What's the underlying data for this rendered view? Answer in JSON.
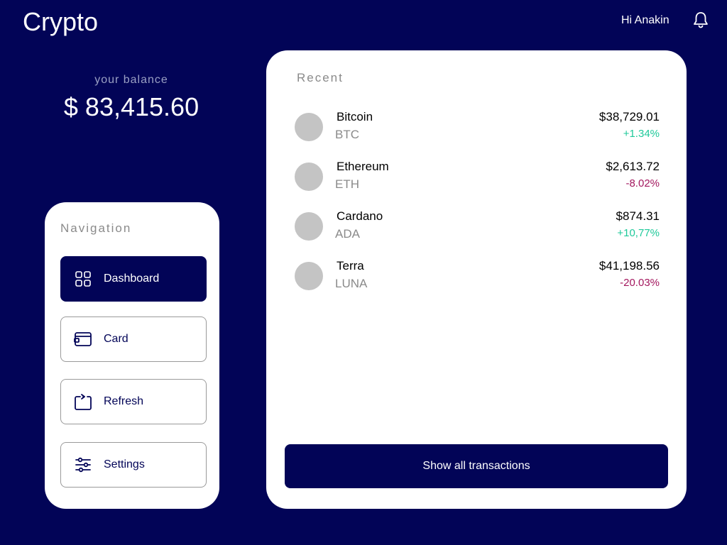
{
  "header": {
    "title": "Crypto",
    "greeting": "Hi Anakin",
    "notification_icon": "bell-icon"
  },
  "balance": {
    "label": "your balance",
    "value": "$ 83,415.60"
  },
  "navigation": {
    "title": "Navigation",
    "items": [
      {
        "label": "Dashboard",
        "icon": "dashboard-grid-icon",
        "active": true
      },
      {
        "label": "Card",
        "icon": "wallet-card-icon",
        "active": false
      },
      {
        "label": "Refresh",
        "icon": "refresh-icon",
        "active": false
      },
      {
        "label": "Settings",
        "icon": "sliders-icon",
        "active": false
      }
    ]
  },
  "recent": {
    "title": "Recent",
    "coins": [
      {
        "name": "Bitcoin",
        "symbol": "BTC",
        "price": "$38,729.01",
        "change": "+1.34%",
        "trend": "up"
      },
      {
        "name": "Ethereum",
        "symbol": "ETH",
        "price": "$2,613.72",
        "change": "-8.02%",
        "trend": "down"
      },
      {
        "name": "Cardano",
        "symbol": "ADA",
        "price": "$874.31",
        "change": "+10,77%",
        "trend": "up"
      },
      {
        "name": "Terra",
        "symbol": "LUNA",
        "price": "$41,198.56",
        "change": "-20.03%",
        "trend": "down"
      }
    ],
    "show_all_label": "Show all transactions"
  },
  "colors": {
    "background": "#020457",
    "accent": "#020457",
    "positive": "#1fc99a",
    "negative": "#a3175e",
    "muted": "#8a8a8a"
  }
}
